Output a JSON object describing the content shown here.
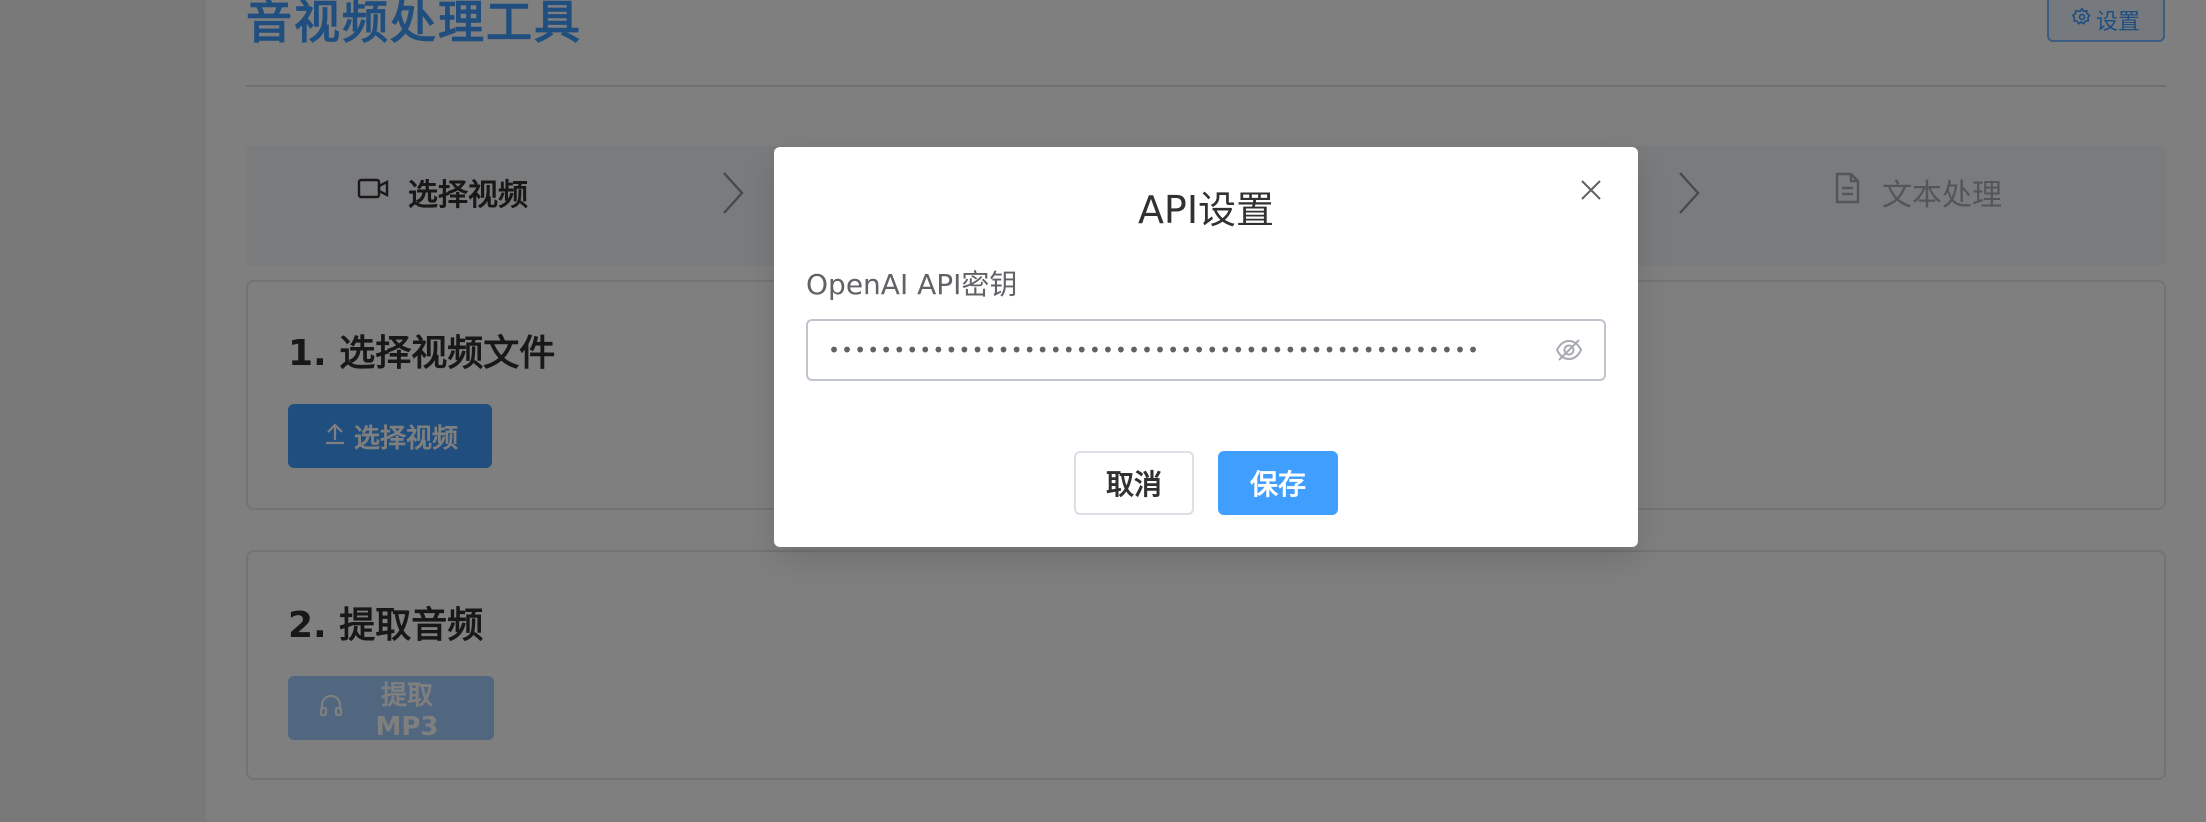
{
  "app": {
    "title": "音视频处理工具",
    "settings_label": "设置"
  },
  "steps": [
    {
      "label": "选择视频",
      "icon": "video-camera-icon",
      "state": "active"
    },
    {
      "label": "文本处理",
      "icon": "document-icon",
      "state": "inactive"
    }
  ],
  "cards": {
    "select_video": {
      "title": "1. 选择视频文件",
      "button_label": "选择视频",
      "button_icon": "upload-icon"
    },
    "extract_audio": {
      "title": "2. 提取音频",
      "button_label": "提取MP3",
      "button_icon": "headphones-icon",
      "button_disabled": true
    }
  },
  "dialog": {
    "title": "API设置",
    "field_label": "OpenAI API密钥",
    "api_key_masked": "••••••••••••••••••••••••••••••••••••••••••••••••••",
    "cancel_label": "取消",
    "save_label": "保存"
  },
  "colors": {
    "primary": "#409eff",
    "primary_disabled": "#a0cfff",
    "overlay": "rgba(0,0,0,0.5)",
    "text_main": "#303133",
    "text_muted": "#a8abb2"
  }
}
